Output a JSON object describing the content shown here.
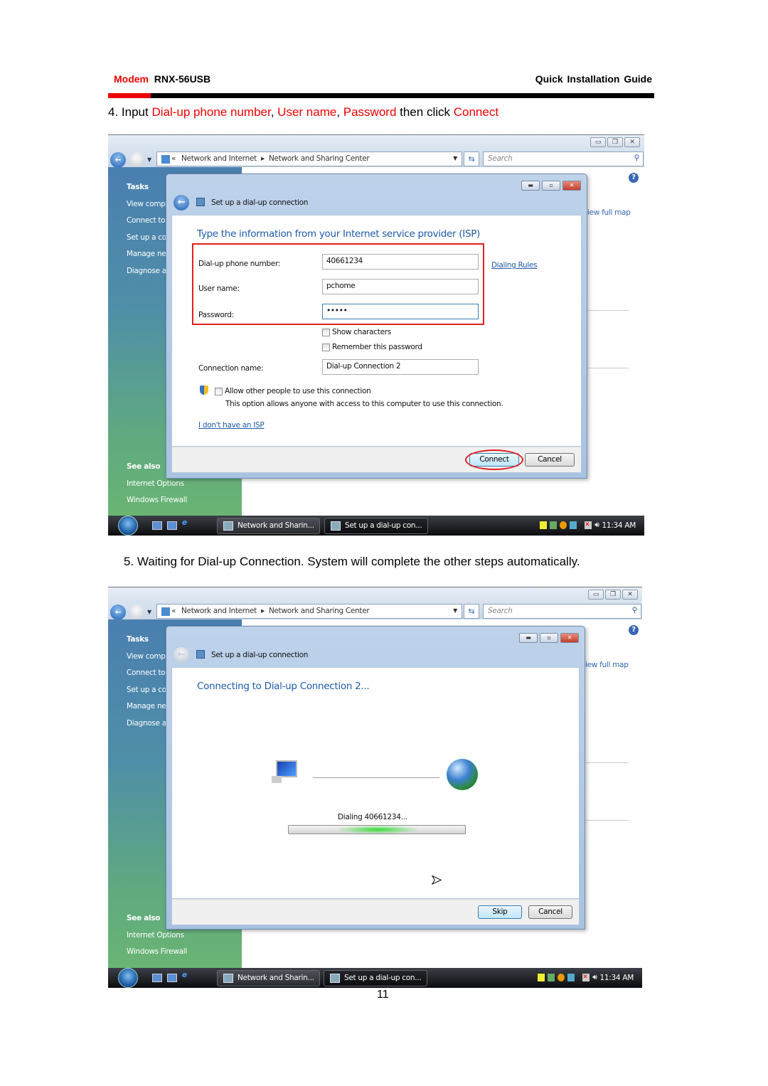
{
  "header": {
    "brand": "Modem",
    "model": "RNX-56USB",
    "guide": "Quick  Installation  Guide"
  },
  "step4": {
    "prefix": "4. Input ",
    "f1": "Dial-up phone number",
    "sep1": ", ",
    "f2": "User name",
    "sep2": ", ",
    "f3": "Password",
    "mid": " then click ",
    "f4": "Connect"
  },
  "step5": {
    "text": "5. Waiting for Dial-up Connection. System will complete the other steps automatically."
  },
  "explorer": {
    "breadcrumb_prefix": "«",
    "crumb1": "Network and Internet",
    "crumb2": "Network and Sharing Center",
    "search_placeholder": "Search",
    "sidebar": {
      "tasks": "Tasks",
      "items": [
        "View comp",
        "Connect to",
        "Set up a co",
        "Manage ne",
        "Diagnose a"
      ],
      "see_also": "See also",
      "links": [
        "Internet Options",
        "Windows Firewall"
      ]
    },
    "view_full_map": "iew full map",
    "taskbar": {
      "btn1": "Network and Sharin...",
      "btn2": "Set up a dial-up con...",
      "clock": "11:34 AM"
    }
  },
  "dialog1": {
    "title": "Set up a dial-up connection",
    "heading": "Type the information from your Internet service provider (ISP)",
    "phone_label": "Dial-up phone number:",
    "phone_value": "40661234",
    "dialing_rules": "Dialing Rules",
    "user_label": "User name:",
    "user_value": "pchome",
    "password_label": "Password:",
    "password_value": "•••••",
    "show_chars": "Show characters",
    "remember": "Remember this password",
    "conn_label": "Connection name:",
    "conn_value": "Dial-up Connection 2",
    "allow": "Allow other people to use this connection",
    "allow_desc": "This option allows anyone with access to this computer to use this connection.",
    "no_isp": "I don't have an ISP",
    "connect": "Connect",
    "cancel": "Cancel"
  },
  "dialog2": {
    "title": "Set up a dial-up connection",
    "heading": "Connecting to Dial-up Connection 2...",
    "status": "Dialing 40661234...",
    "skip": "Skip",
    "cancel": "Cancel"
  },
  "page_number": "11",
  "colors": {
    "accent_red": "#e00000",
    "link_blue": "#1e5aa8"
  }
}
